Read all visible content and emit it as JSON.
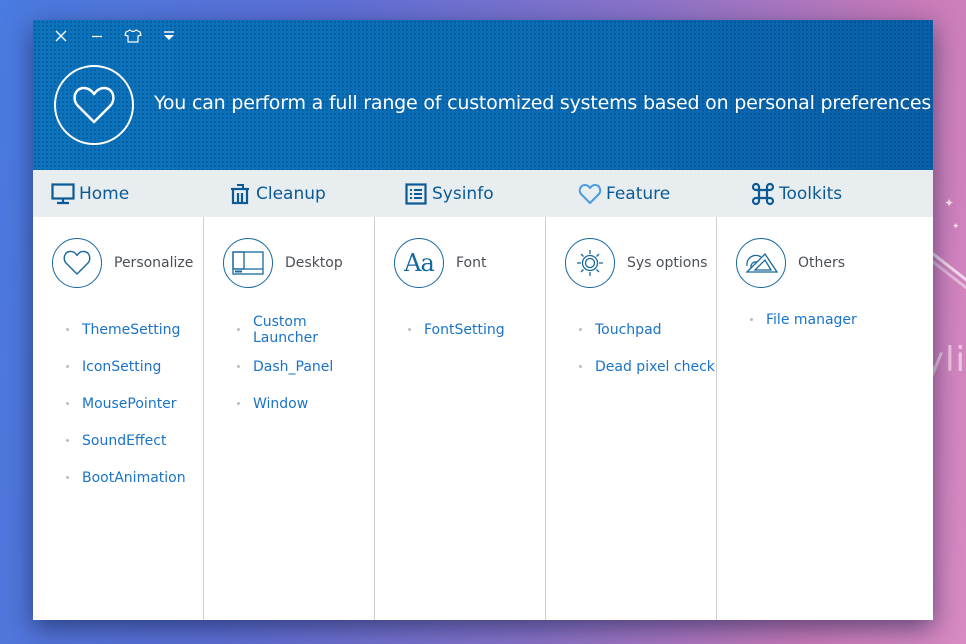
{
  "window": {
    "controls": [
      {
        "name": "close-button",
        "icon": "close-icon"
      },
      {
        "name": "minimize-button",
        "icon": "minimize-icon"
      },
      {
        "name": "skin-button",
        "icon": "tshirt-icon"
      },
      {
        "name": "menu-button",
        "icon": "dropdown-menu-icon"
      }
    ]
  },
  "banner": {
    "icon": "heart-icon",
    "text": "You can perform a full range of customized systems based on personal preferences"
  },
  "tabs": [
    {
      "label": "Home",
      "icon": "monitor-icon"
    },
    {
      "label": "Cleanup",
      "icon": "trash-icon"
    },
    {
      "label": "Sysinfo",
      "icon": "list-icon"
    },
    {
      "label": "Feature",
      "icon": "heart-icon",
      "active": true
    },
    {
      "label": "Toolkits",
      "icon": "command-icon"
    }
  ],
  "sections": [
    {
      "title": "Personalize",
      "icon": "heart-icon",
      "items": [
        "ThemeSetting",
        "IconSetting",
        "MousePointer",
        "SoundEffect",
        "BootAnimation"
      ]
    },
    {
      "title": "Desktop",
      "icon": "desktop-window-icon",
      "items": [
        "Custom Launcher",
        "Dash_Panel",
        "Window"
      ]
    },
    {
      "title": "Font",
      "icon": "font-icon",
      "icon_text": "Aa",
      "items": [
        "FontSetting"
      ]
    },
    {
      "title": "Sys options",
      "icon": "sun-gear-icon",
      "items": [
        "Touchpad",
        "Dead pixel check"
      ]
    },
    {
      "title": "Others",
      "icon": "tools-icon",
      "items": [
        "File manager"
      ]
    }
  ],
  "desktop": {
    "watermark": "Kyli"
  },
  "colors": {
    "banner": "#0a6db5",
    "tab_bar": "#e8edf0",
    "tab_text": "#0b5a96",
    "feature_tab_icon": "#4a9be0",
    "link": "#1a73c8",
    "section_title": "#4a4f57"
  }
}
